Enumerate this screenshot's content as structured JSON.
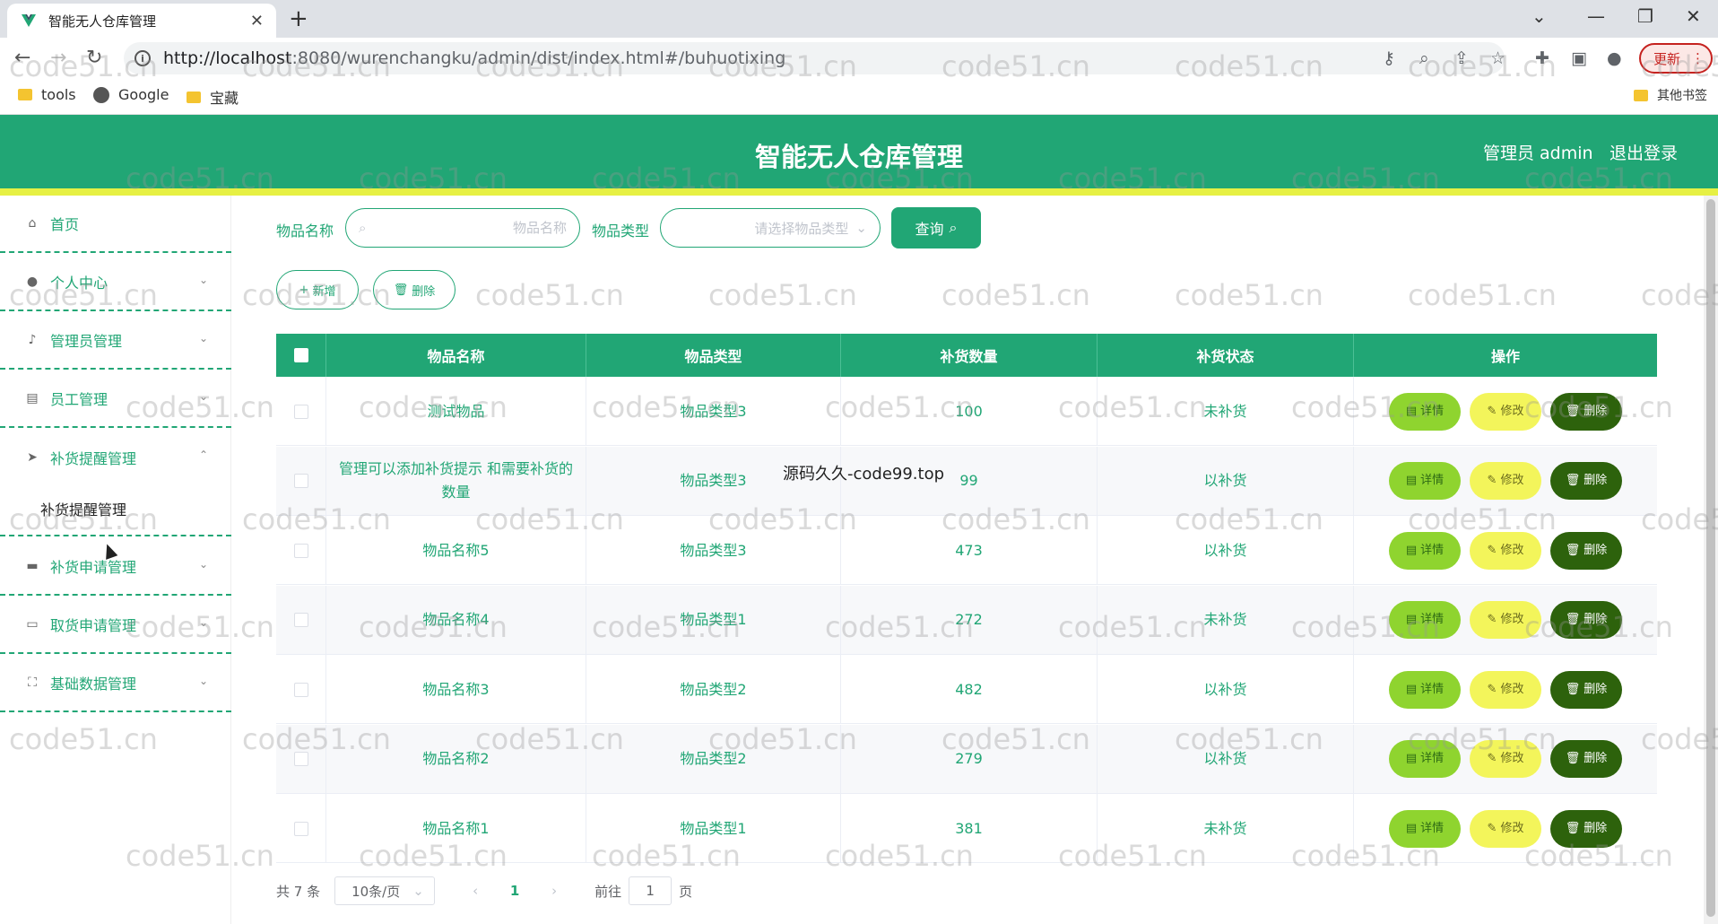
{
  "browser": {
    "tab_title": "智能无人仓库管理",
    "url_prefix": "http://localhost",
    "url_rest": ":8080/wurenchangku/admin/dist/index.html#/buhuotixing",
    "update_label": "更新",
    "bookmarks": [
      "tools",
      "Google",
      "宝藏"
    ],
    "other_bookmarks": "其他书签"
  },
  "header": {
    "title": "智能无人仓库管理",
    "user": "管理员 admin",
    "logout": "退出登录"
  },
  "sidebar": {
    "items": [
      {
        "label": "首页",
        "icon": "home-icon"
      },
      {
        "label": "个人中心",
        "icon": "user-icon"
      },
      {
        "label": "管理员管理",
        "icon": "mic-icon"
      },
      {
        "label": "员工管理",
        "icon": "chat-icon"
      },
      {
        "label": "补货提醒管理",
        "icon": "send-icon"
      },
      {
        "label": "补货申请管理",
        "icon": "suitcase-icon"
      },
      {
        "label": "取货申请管理",
        "icon": "message-icon"
      },
      {
        "label": "基础数据管理",
        "icon": "fullscreen-icon"
      }
    ],
    "sub_item": "补货提醒管理"
  },
  "search": {
    "name_label": "物品名称",
    "name_placeholder": "物品名称",
    "type_label": "物品类型",
    "type_placeholder": "请选择物品类型",
    "query_label": "查询"
  },
  "actions": {
    "add_label": "新增",
    "delete_label": "删除"
  },
  "table": {
    "headers": [
      "物品名称",
      "物品类型",
      "补货数量",
      "补货状态",
      "操作"
    ],
    "rows": [
      {
        "name": "测试物品",
        "type": "物品类型3",
        "qty": "100",
        "status": "未补货"
      },
      {
        "name": "管理可以添加补货提示 和需要补货的数量",
        "type": "物品类型3",
        "qty": "99",
        "status": "以补货"
      },
      {
        "name": "物品名称5",
        "type": "物品类型3",
        "qty": "473",
        "status": "以补货"
      },
      {
        "name": "物品名称4",
        "type": "物品类型1",
        "qty": "272",
        "status": "未补货"
      },
      {
        "name": "物品名称3",
        "type": "物品类型2",
        "qty": "482",
        "status": "以补货"
      },
      {
        "name": "物品名称2",
        "type": "物品类型2",
        "qty": "279",
        "status": "以补货"
      },
      {
        "name": "物品名称1",
        "type": "物品类型1",
        "qty": "381",
        "status": "未补货"
      }
    ],
    "op_detail": "详情",
    "op_edit": "修改",
    "op_delete": "删除"
  },
  "pagination": {
    "total": "共 7 条",
    "page_size": "10条/页",
    "current": "1",
    "goto_prefix": "前往",
    "goto_value": "1",
    "goto_suffix": "页"
  },
  "overlay_text": "源码久久-code99.top",
  "watermark": "code51.cn",
  "colors": {
    "brand": "#21a675",
    "stripe": "#e6f044",
    "detail": "#8fd42f",
    "edit": "#f3f55b",
    "delete": "#2d620c"
  }
}
